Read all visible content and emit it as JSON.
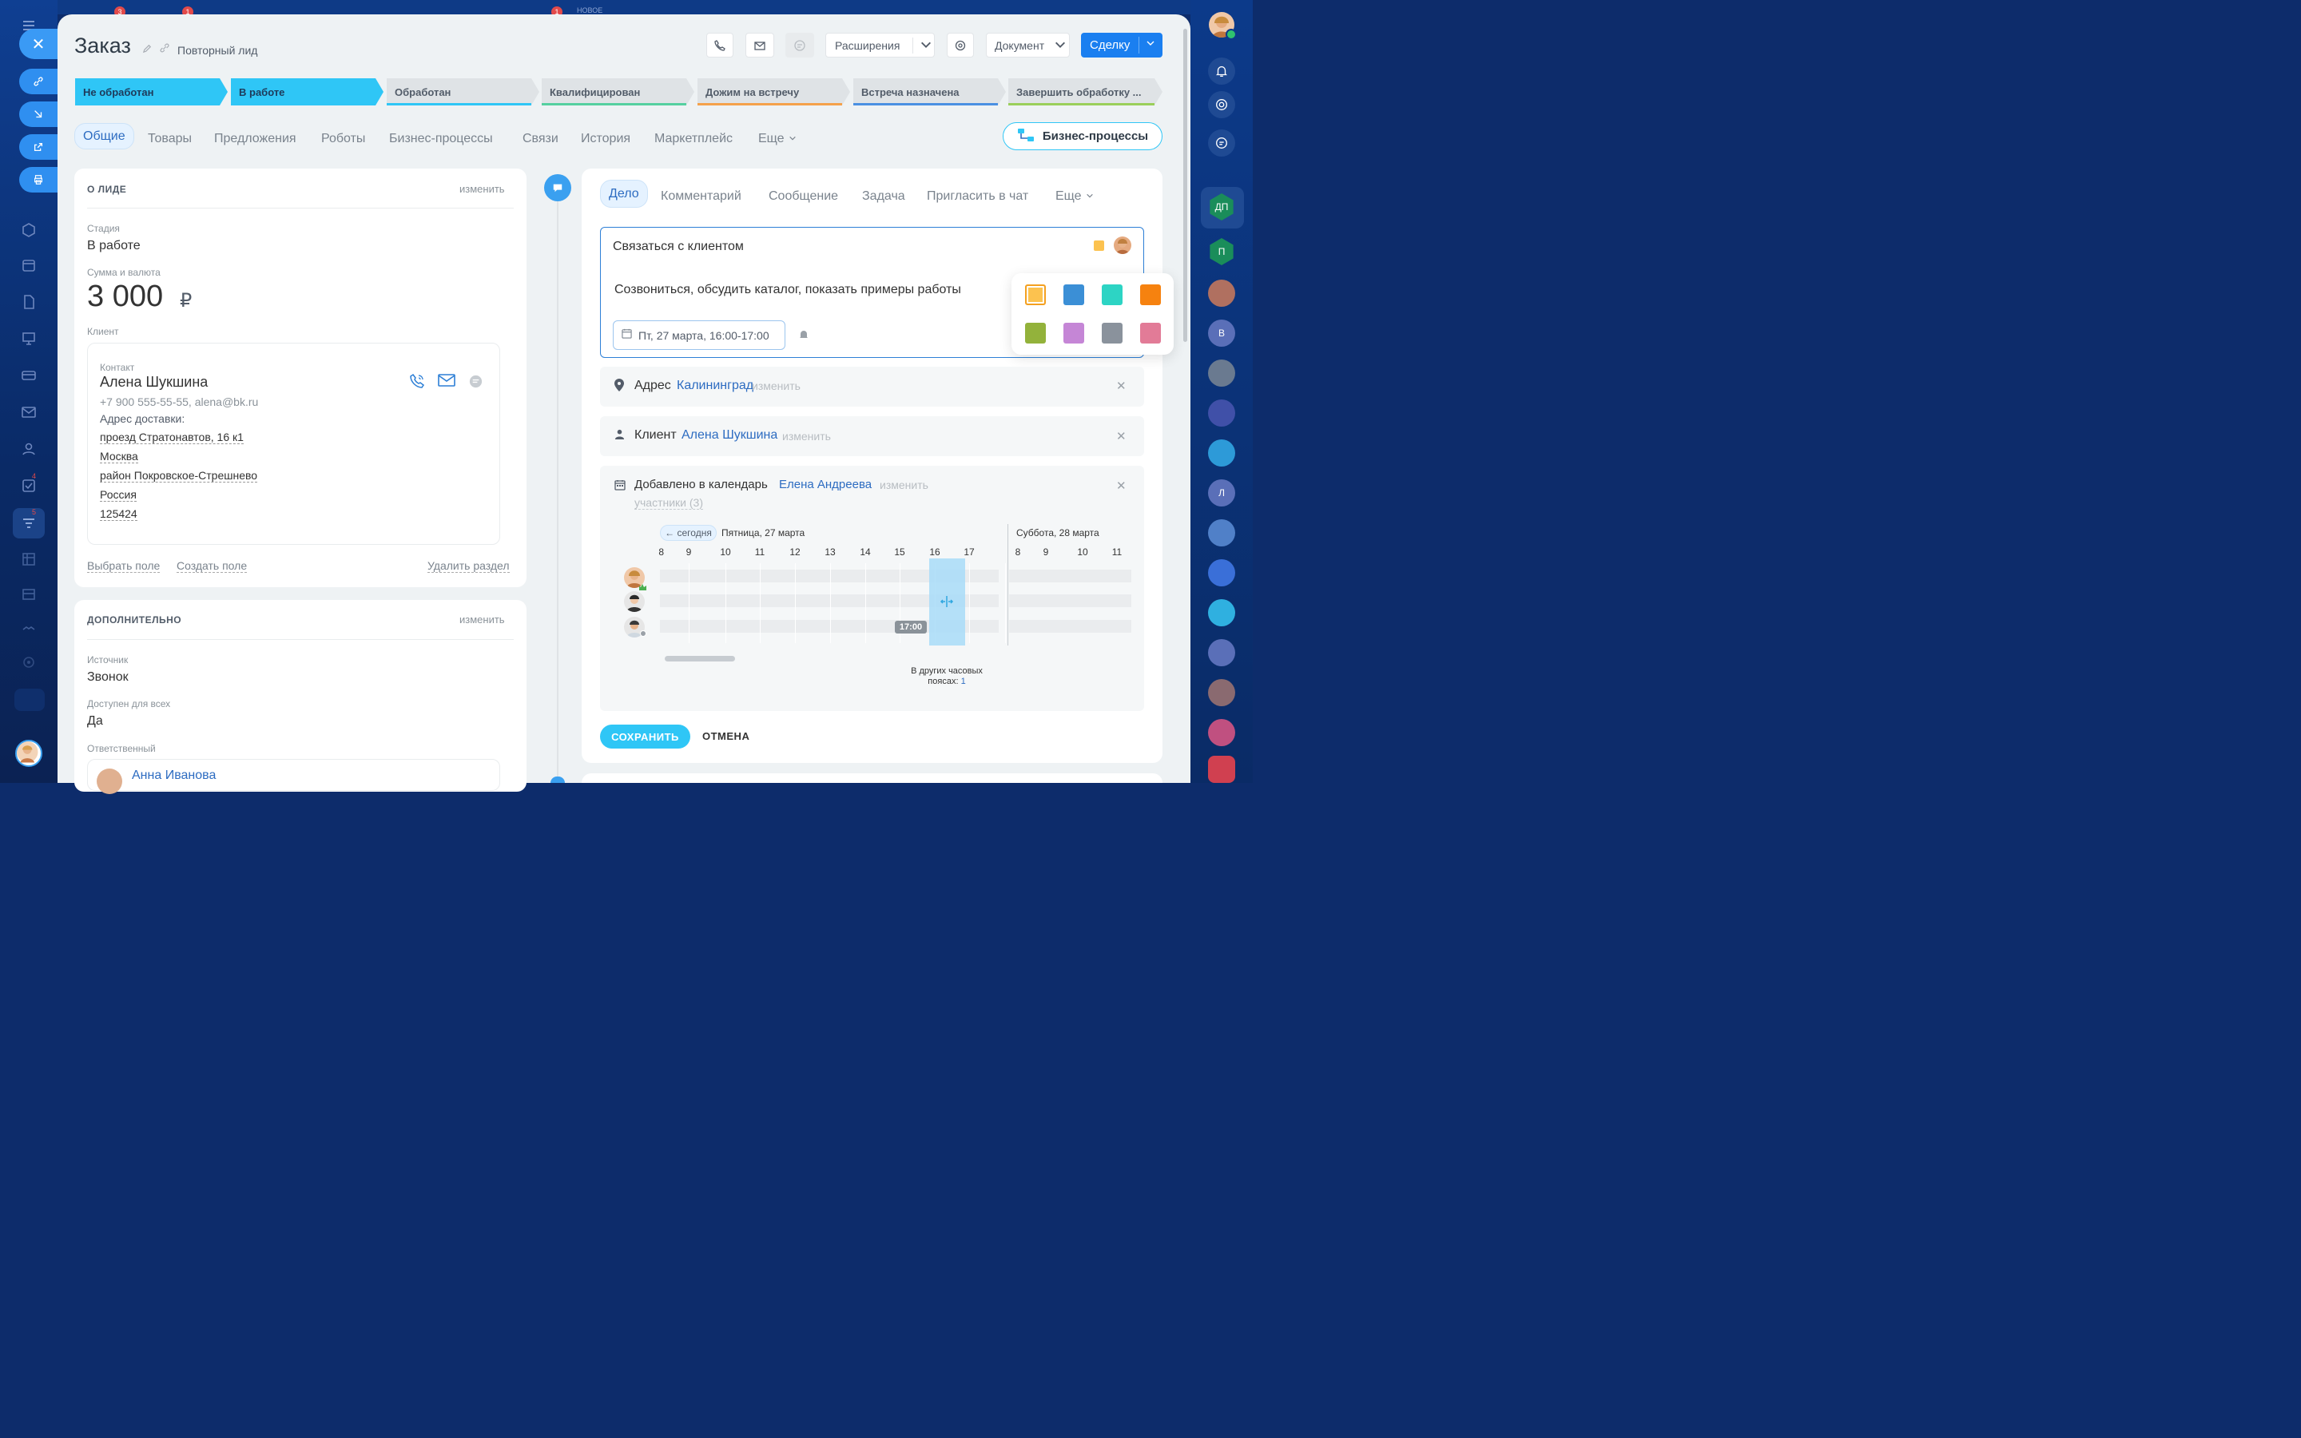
{
  "top_ghost": {
    "badge_a": "3",
    "badge_b": "1",
    "badge_c": "1",
    "label": "НОВОЕ"
  },
  "left_rail": {
    "tasks_badge": "4",
    "crm_badge": "5"
  },
  "right_rail": {
    "dp": "ДП",
    "p": "П",
    "v": "В",
    "l": "Л"
  },
  "header": {
    "title": "Заказ",
    "subtitle": "Повторный лид",
    "extensions": "Расширения",
    "document": "Документ",
    "deal": "Сделку"
  },
  "stages": [
    "Не обработан",
    "В работе",
    "Обработан",
    "Квалифицирован",
    "Дожим на встречу",
    "Встреча назначена",
    "Завершить обработку ..."
  ],
  "tabs": [
    "Общие",
    "Товары",
    "Предложения",
    "Роботы",
    "Бизнес-процессы",
    "Связи",
    "История",
    "Маркетплейс",
    "Еще"
  ],
  "bp_button": "Бизнес-процессы",
  "lead": {
    "section_title": "О ЛИДЕ",
    "edit": "изменить",
    "stage_label": "Стадия",
    "stage_value": "В работе",
    "sum_label": "Сумма и валюта",
    "sum_value": "3 000",
    "currency": "₽",
    "client_label": "Клиент",
    "contact_label": "Контакт",
    "contact_name": "Алена Шукшина",
    "contact_info": "+7 900 555-55-55, alena@bk.ru",
    "address_label": "Адрес доставки:",
    "address_lines": [
      "проезд Стратонавтов, 16 к1",
      "Москва",
      "район Покровское-Стрешнево",
      "Россия",
      "125424"
    ],
    "choose_field": "Выбрать поле",
    "create_field": "Создать поле",
    "delete_section": "Удалить раздел"
  },
  "extra": {
    "section_title": "ДОПОЛНИТЕЛЬНО",
    "edit": "изменить",
    "source_label": "Источник",
    "source_value": "Звонок",
    "public_label": "Доступен для всех",
    "public_value": "Да",
    "responsible_label": "Ответственный",
    "responsible_name": "Анна Иванова"
  },
  "activity": {
    "tabs": [
      "Дело",
      "Комментарий",
      "Сообщение",
      "Задача",
      "Пригласить в чат",
      "Еще"
    ],
    "task_title": "Связаться с клиентом",
    "task_desc": "Созвониться, обсудить каталог, показать примеры работы",
    "date": "Пт, 27 марта, 16:00-17:00",
    "colors": [
      "#fcc24f",
      "#3b8fd6",
      "#2dd4c4",
      "#f6820f",
      "#93b23b",
      "#c586d6",
      "#8a929c",
      "#e27b97"
    ],
    "address_label": "Адрес",
    "address_value": "Калининград",
    "address_edit": "изменить",
    "client_label": "Клиент",
    "client_value": "Алена Шукшина",
    "client_edit": "изменить",
    "calendar_label": "Добавлено в календарь",
    "calendar_value": "Елена Андреева",
    "calendar_edit": "изменить",
    "participants": "участники (3)",
    "today": "← сегодня",
    "day1": "Пятница, 27 марта",
    "day2": "Суббота, 28 марта",
    "hours1": [
      "8",
      "9",
      "10",
      "11",
      "12",
      "13",
      "14",
      "15",
      "16",
      "17"
    ],
    "hours2": [
      "8",
      "9",
      "10",
      "11"
    ],
    "time_badge": "17:00",
    "tz_line1": "В других часовых",
    "tz_line2": "поясах:",
    "tz_count": "1",
    "save": "СОХРАНИТЬ",
    "cancel": "ОТМЕНА"
  }
}
